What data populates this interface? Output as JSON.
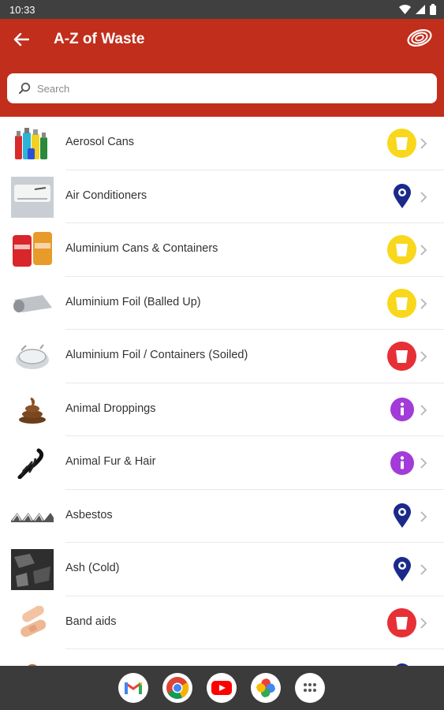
{
  "status_bar": {
    "time": "10:33",
    "icons": [
      "wifi-icon",
      "signal-icon",
      "battery-icon"
    ]
  },
  "app_bar": {
    "title": "A-Z of Waste",
    "back_icon": "arrow-left-icon",
    "logo": "council-swirl-logo",
    "color": "#c12e1c"
  },
  "search": {
    "placeholder": "Search",
    "value": ""
  },
  "colors": {
    "general_bin": "#e63036",
    "recycling_bin": "#f9d71c",
    "info": "#a23bd8",
    "location": "#1b2a8a"
  },
  "items": [
    {
      "label": "Aerosol Cans",
      "thumb": "aerosol-cans-image",
      "disposal": "recycling-bin-icon"
    },
    {
      "label": "Air Conditioners",
      "thumb": "air-conditioner-image",
      "disposal": "location-pin-icon"
    },
    {
      "label": "Aluminium Cans & Containers",
      "thumb": "aluminium-cans-image",
      "disposal": "recycling-bin-icon"
    },
    {
      "label": "Aluminium Foil (Balled Up)",
      "thumb": "aluminium-foil-image",
      "disposal": "recycling-bin-icon"
    },
    {
      "label": "Aluminium Foil / Containers (Soiled)",
      "thumb": "foil-container-image",
      "disposal": "general-waste-bin-icon"
    },
    {
      "label": "Animal Droppings",
      "thumb": "animal-droppings-image",
      "disposal": "info-icon"
    },
    {
      "label": "Animal Fur & Hair",
      "thumb": "animal-fur-image",
      "disposal": "info-icon"
    },
    {
      "label": "Asbestos",
      "thumb": "asbestos-image",
      "disposal": "location-pin-icon"
    },
    {
      "label": "Ash (Cold)",
      "thumb": "ash-image",
      "disposal": "location-pin-icon"
    },
    {
      "label": "Band aids",
      "thumb": "band-aids-image",
      "disposal": "general-waste-bin-icon"
    },
    {
      "label": "",
      "thumb": "basket-image",
      "disposal": "location-pin-icon"
    }
  ],
  "nav_apps": [
    "gmail-icon",
    "chrome-icon",
    "youtube-icon",
    "photos-icon",
    "app-drawer-icon"
  ]
}
